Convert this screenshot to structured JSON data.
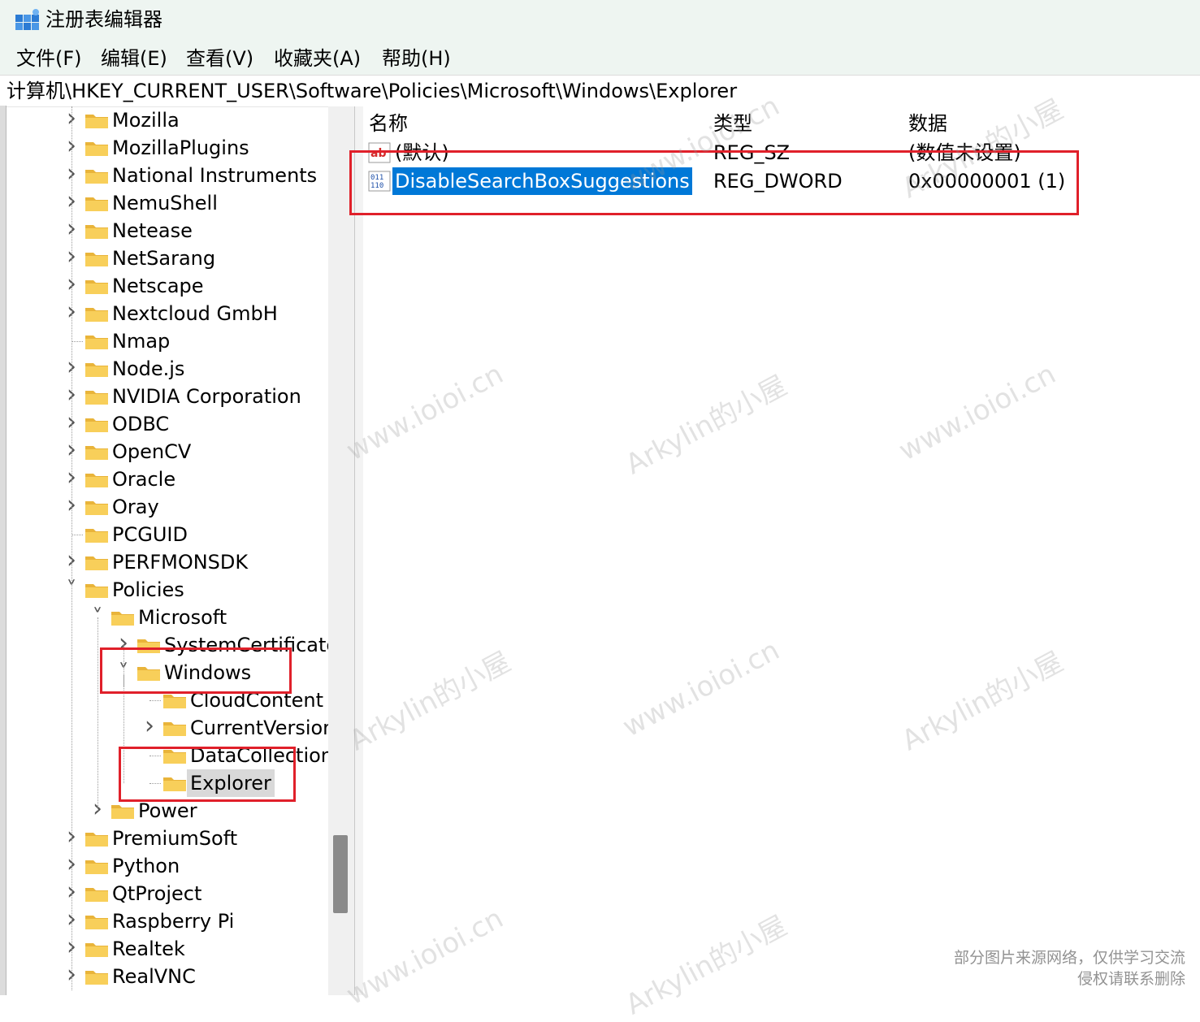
{
  "window": {
    "title": "注册表编辑器",
    "icon": "regedit-icon"
  },
  "menu": [
    "文件(F)",
    "编辑(E)",
    "查看(V)",
    "收藏夹(A)",
    "帮助(H)"
  ],
  "address": "计算机\\HKEY_CURRENT_USER\\Software\\Policies\\Microsoft\\Windows\\Explorer",
  "tree": [
    {
      "label": "Mozilla",
      "level": 0,
      "expander": "collapsed"
    },
    {
      "label": "MozillaPlugins",
      "level": 0,
      "expander": "collapsed"
    },
    {
      "label": "National Instruments",
      "level": 0,
      "expander": "collapsed"
    },
    {
      "label": "NemuShell",
      "level": 0,
      "expander": "collapsed"
    },
    {
      "label": "Netease",
      "level": 0,
      "expander": "collapsed"
    },
    {
      "label": "NetSarang",
      "level": 0,
      "expander": "collapsed"
    },
    {
      "label": "Netscape",
      "level": 0,
      "expander": "collapsed"
    },
    {
      "label": "Nextcloud GmbH",
      "level": 0,
      "expander": "collapsed"
    },
    {
      "label": "Nmap",
      "level": 0,
      "expander": "none"
    },
    {
      "label": "Node.js",
      "level": 0,
      "expander": "collapsed"
    },
    {
      "label": "NVIDIA Corporation",
      "level": 0,
      "expander": "collapsed"
    },
    {
      "label": "ODBC",
      "level": 0,
      "expander": "collapsed"
    },
    {
      "label": "OpenCV",
      "level": 0,
      "expander": "collapsed"
    },
    {
      "label": "Oracle",
      "level": 0,
      "expander": "collapsed"
    },
    {
      "label": "Oray",
      "level": 0,
      "expander": "collapsed"
    },
    {
      "label": "PCGUID",
      "level": 0,
      "expander": "none"
    },
    {
      "label": "PERFMONSDK",
      "level": 0,
      "expander": "collapsed"
    },
    {
      "label": "Policies",
      "level": 0,
      "expander": "expanded"
    },
    {
      "label": "Microsoft",
      "level": 1,
      "expander": "expanded"
    },
    {
      "label": "SystemCertificate",
      "level": 2,
      "expander": "collapsed"
    },
    {
      "label": "Windows",
      "level": 2,
      "expander": "expanded"
    },
    {
      "label": "CloudContent",
      "level": 3,
      "expander": "none"
    },
    {
      "label": "CurrentVersion",
      "level": 3,
      "expander": "collapsed"
    },
    {
      "label": "DataCollection",
      "level": 3,
      "expander": "none"
    },
    {
      "label": "Explorer",
      "level": 3,
      "expander": "none",
      "selected": true
    },
    {
      "label": "Power",
      "level": 1,
      "expander": "collapsed"
    },
    {
      "label": "PremiumSoft",
      "level": 0,
      "expander": "collapsed"
    },
    {
      "label": "Python",
      "level": 0,
      "expander": "collapsed"
    },
    {
      "label": "QtProject",
      "level": 0,
      "expander": "collapsed"
    },
    {
      "label": "Raspberry Pi",
      "level": 0,
      "expander": "collapsed"
    },
    {
      "label": "Realtek",
      "level": 0,
      "expander": "collapsed"
    },
    {
      "label": "RealVNC",
      "level": 0,
      "expander": "collapsed"
    }
  ],
  "list": {
    "headers": {
      "name": "名称",
      "type": "类型",
      "data": "数据"
    },
    "rows": [
      {
        "name": "(默认)",
        "type": "REG_SZ",
        "data": "(数值未设置)",
        "icon": "string-value-icon"
      },
      {
        "name": "DisableSearchBoxSuggestions",
        "type": "REG_DWORD",
        "data": "0x00000001 (1)",
        "icon": "binary-value-icon",
        "selected": true
      }
    ]
  },
  "watermarks": [
    "www.ioioi.cn",
    "Arkylin的小屋"
  ],
  "notice": {
    "line1": "部分图片来源网络，仅供学习交流",
    "line2": "侵权请联系删除"
  },
  "colors": {
    "highlight_box": "#e0202a",
    "selection": "#0078d7",
    "folder": "#f5c242"
  }
}
